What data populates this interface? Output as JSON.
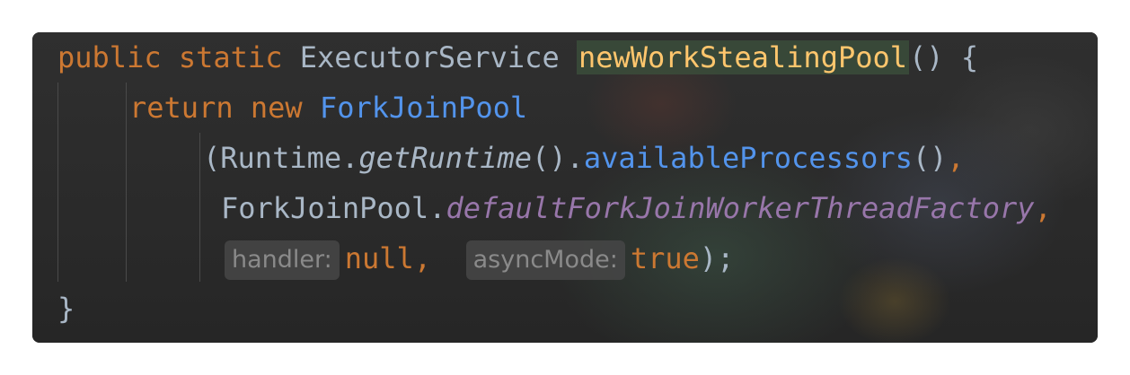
{
  "code": {
    "line1": {
      "kw_public": "public",
      "kw_static": "static",
      "return_type": "ExecutorService",
      "method_name": "newWorkStealingPool",
      "params_open": "() {"
    },
    "line2": {
      "kw_return": "return",
      "kw_new": "new",
      "class_name": "ForkJoinPool"
    },
    "line3": {
      "open_paren": "(",
      "runtime_class": "Runtime",
      "dot1": ".",
      "get_runtime": "getRuntime",
      "call1": "()",
      "dot2": ".",
      "available_processors": "availableProcessors",
      "call2": "()",
      "comma": ","
    },
    "line4": {
      "class_ref": "ForkJoinPool",
      "dot": ".",
      "factory_field": "defaultForkJoinWorkerThreadFactory",
      "comma": ","
    },
    "line5": {
      "hint_handler": "handler:",
      "null_value": "null",
      "comma": ",",
      "hint_async_mode": "asyncMode:",
      "true_value": "true",
      "close": ");"
    },
    "line6": {
      "close_brace": "}"
    }
  },
  "colors": {
    "keyword": "#cc7832",
    "plain": "#a9b7c6",
    "method_declaration": "#ffc66d",
    "method_call": "#5394ec",
    "static_field": "#9876aa",
    "hint": "#8a8a8a"
  }
}
